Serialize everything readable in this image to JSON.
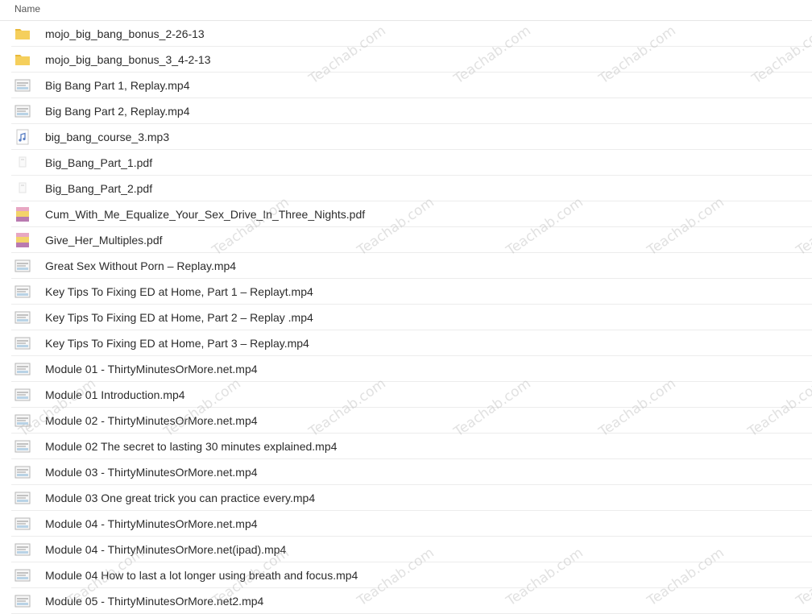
{
  "header": {
    "name_label": "Name"
  },
  "files": [
    {
      "name": "mojo_big_bang_bonus_2-26-13",
      "icon": "folder-icon"
    },
    {
      "name": "mojo_big_bang_bonus_3_4-2-13",
      "icon": "folder-icon"
    },
    {
      "name": "Big Bang Part 1, Replay.mp4",
      "icon": "video-file-icon"
    },
    {
      "name": "Big Bang Part 2, Replay.mp4",
      "icon": "video-file-icon"
    },
    {
      "name": "big_bang_course_3.mp3",
      "icon": "audio-file-icon"
    },
    {
      "name": "Big_Bang_Part_1.pdf",
      "icon": "blank-file-icon"
    },
    {
      "name": "Big_Bang_Part_2.pdf",
      "icon": "blank-file-icon"
    },
    {
      "name": "Cum_With_Me_Equalize_Your_Sex_Drive_In_Three_Nights.pdf",
      "icon": "pdf-cover-icon"
    },
    {
      "name": "Give_Her_Multiples.pdf",
      "icon": "pdf-cover-icon"
    },
    {
      "name": "Great Sex Without Porn – Replay.mp4",
      "icon": "video-file-icon"
    },
    {
      "name": "Key Tips To Fixing ED at Home, Part 1 – Replayt.mp4",
      "icon": "video-file-icon"
    },
    {
      "name": "Key Tips To Fixing ED at Home, Part 2 – Replay .mp4",
      "icon": "video-file-icon"
    },
    {
      "name": "Key Tips To Fixing ED at Home, Part 3 – Replay.mp4",
      "icon": "video-file-icon"
    },
    {
      "name": "Module 01 - ThirtyMinutesOrMore.net.mp4",
      "icon": "video-file-icon"
    },
    {
      "name": "Module 01 Introduction.mp4",
      "icon": "video-file-icon"
    },
    {
      "name": "Module 02 - ThirtyMinutesOrMore.net.mp4",
      "icon": "video-file-icon"
    },
    {
      "name": "Module 02 The secret to lasting 30 minutes explained.mp4",
      "icon": "video-file-icon"
    },
    {
      "name": "Module 03 - ThirtyMinutesOrMore.net.mp4",
      "icon": "video-file-icon"
    },
    {
      "name": "Module 03 One great trick you can practice every.mp4",
      "icon": "video-file-icon"
    },
    {
      "name": "Module 04 - ThirtyMinutesOrMore.net.mp4",
      "icon": "video-file-icon"
    },
    {
      "name": "Module 04 - ThirtyMinutesOrMore.net(ipad).mp4",
      "icon": "video-file-icon"
    },
    {
      "name": "Module 04 How to last a lot longer using breath and focus.mp4",
      "icon": "video-file-icon"
    },
    {
      "name": "Module 05 - ThirtyMinutesOrMore.net2.mp4",
      "icon": "video-file-icon"
    }
  ],
  "watermark": {
    "text": "Teachab.com"
  },
  "colors": {
    "folder": "#f5cf5c",
    "folder_tab": "#e9b93a",
    "row_border": "#ececec",
    "text": "#2b2b2b"
  }
}
